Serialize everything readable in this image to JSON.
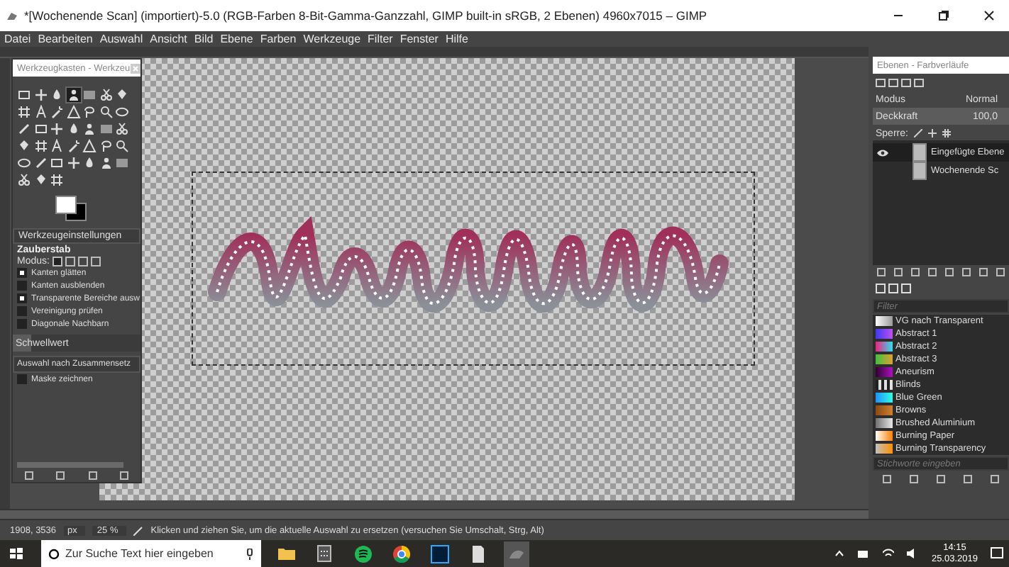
{
  "window": {
    "title": "*[Wochenende Scan] (importiert)-5.0 (RGB-Farben 8-Bit-Gamma-Ganzzahl, GIMP built-in sRGB, 2 Ebenen) 4960x7015 – GIMP"
  },
  "menu": [
    "Datei",
    "Bearbeiten",
    "Auswahl",
    "Ansicht",
    "Bild",
    "Ebene",
    "Farben",
    "Werkzeuge",
    "Filter",
    "Fenster",
    "Hilfe"
  ],
  "toolbox": {
    "title": "Werkzeugkasten - Werkzeu",
    "tools": [
      {
        "selected": false
      },
      {
        "selected": false
      },
      {
        "selected": false
      },
      {
        "selected": true
      },
      {
        "selected": false
      },
      {
        "selected": false
      },
      {
        "selected": false
      },
      {
        "selected": false
      },
      {
        "selected": false
      },
      {
        "selected": false
      },
      {
        "selected": false
      },
      {
        "selected": false
      },
      {
        "selected": false
      },
      {
        "selected": false
      },
      {
        "selected": false
      },
      {
        "selected": false
      },
      {
        "selected": false
      },
      {
        "selected": false
      },
      {
        "selected": false
      },
      {
        "selected": false
      },
      {
        "selected": false
      },
      {
        "selected": false
      },
      {
        "selected": false
      },
      {
        "selected": false
      },
      {
        "selected": false
      },
      {
        "selected": false
      },
      {
        "selected": false
      },
      {
        "selected": false
      },
      {
        "selected": false
      },
      {
        "selected": false
      },
      {
        "selected": false
      },
      {
        "selected": false
      },
      {
        "selected": false
      },
      {
        "selected": false
      },
      {
        "selected": false
      },
      {
        "selected": false
      },
      {
        "selected": false
      },
      {
        "selected": false
      }
    ],
    "options_title": "Werkzeugeinstellungen",
    "tool_name": "Zauberstab",
    "mode_label": "Modus:",
    "checks": [
      {
        "label": "Kanten glätten",
        "checked": true
      },
      {
        "label": "Kanten ausblenden",
        "checked": false
      },
      {
        "label": "Transparente Bereiche ausw",
        "checked": true
      },
      {
        "label": "Vereinigung prüfen",
        "checked": false
      },
      {
        "label": "Diagonale Nachbarn",
        "checked": false
      }
    ],
    "threshold": {
      "label": "Schwellwert",
      "level": 0.14
    },
    "select_by": "Auswahl nach Zusammensetz",
    "mask": {
      "label": "Maske zeichnen",
      "checked": false
    }
  },
  "layers_dock": {
    "title": "Ebenen - Farbverläufe",
    "mode_label": "Modus",
    "mode_value": "Normal",
    "opacity": {
      "label": "Deckkraft",
      "value": "100,0",
      "level": 1
    },
    "lock_label": "Sperre:",
    "layers": [
      {
        "name": "Eingefügte Ebene",
        "visible": true,
        "selected": true
      },
      {
        "name": "Wochenende Sc",
        "visible": false,
        "selected": false
      }
    ]
  },
  "gradients": {
    "filter_placeholder": "Filter",
    "tags_placeholder": "Stichworte eingeben",
    "items": [
      {
        "name": "VG nach Transparent"
      },
      {
        "name": "Abstract 1"
      },
      {
        "name": "Abstract 2"
      },
      {
        "name": "Abstract 3"
      },
      {
        "name": "Aneurism"
      },
      {
        "name": "Blinds"
      },
      {
        "name": "Blue Green"
      },
      {
        "name": "Browns"
      },
      {
        "name": "Brushed Aluminium"
      },
      {
        "name": "Burning Paper"
      },
      {
        "name": "Burning Transparency"
      }
    ]
  },
  "status_bar": {
    "coordinates": "1908, 3536",
    "unit": "px",
    "zoom": "25 %",
    "message": "Klicken und ziehen Sie, um die aktuelle Auswahl zu ersetzen (versuchen Sie Umschalt, Strg, Alt)"
  },
  "taskbar": {
    "search_placeholder": "Zur Suche Text hier eingeben",
    "time": "14:15",
    "date": "25.03.2019"
  }
}
